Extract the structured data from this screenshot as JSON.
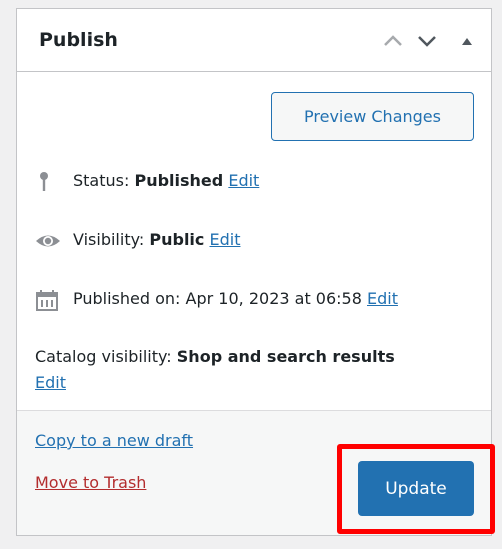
{
  "panel": {
    "title": "Publish",
    "controls": {
      "move_up": "chevron-up-icon",
      "move_down": "chevron-down-icon",
      "toggle": "triangle-up-icon"
    }
  },
  "actions": {
    "preview_label": "Preview Changes"
  },
  "meta": {
    "status": {
      "icon": "pin-icon",
      "label": "Status: ",
      "value": "Published",
      "edit": "Edit"
    },
    "visibility": {
      "icon": "eye-icon",
      "label": "Visibility: ",
      "value": "Public",
      "edit": "Edit"
    },
    "published": {
      "icon": "calendar-icon",
      "label": "Published on: ",
      "value": "Apr 10, 2023 at 06:58",
      "edit": "Edit"
    },
    "catalog": {
      "label": "Catalog visibility: ",
      "value": "Shop and search results",
      "edit": "Edit"
    }
  },
  "footer": {
    "copy_draft": "Copy to a new draft",
    "trash": "Move to Trash",
    "update_label": "Update"
  },
  "colors": {
    "accent": "#2271b1",
    "danger": "#b32d2e",
    "highlight": "#ff0000"
  }
}
